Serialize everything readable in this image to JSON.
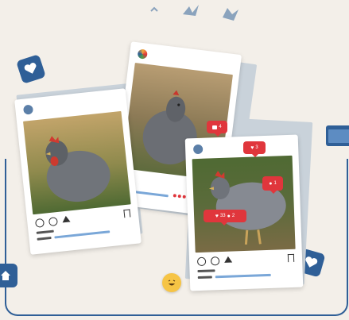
{
  "colors": {
    "background": "#f3efe9",
    "accent_blue": "#2f5f97",
    "notification_red": "#e0363c",
    "card_white": "#ffffff"
  },
  "posts": [
    {
      "name": "post-left"
    },
    {
      "name": "post-middle"
    },
    {
      "name": "post-right"
    }
  ],
  "notifications": [
    {
      "icon": "comment-icon",
      "count": "4"
    },
    {
      "icon": "heart-icon",
      "count": "3"
    },
    {
      "icon": "person-icon",
      "count": "1"
    },
    {
      "icon": "heart-icon",
      "count": "33"
    },
    {
      "icon": "person-icon",
      "count": "2"
    }
  ],
  "decor_icons": [
    "heart-badge-icon",
    "browser-window-icon",
    "home-icon",
    "laughing-emoji-icon"
  ]
}
